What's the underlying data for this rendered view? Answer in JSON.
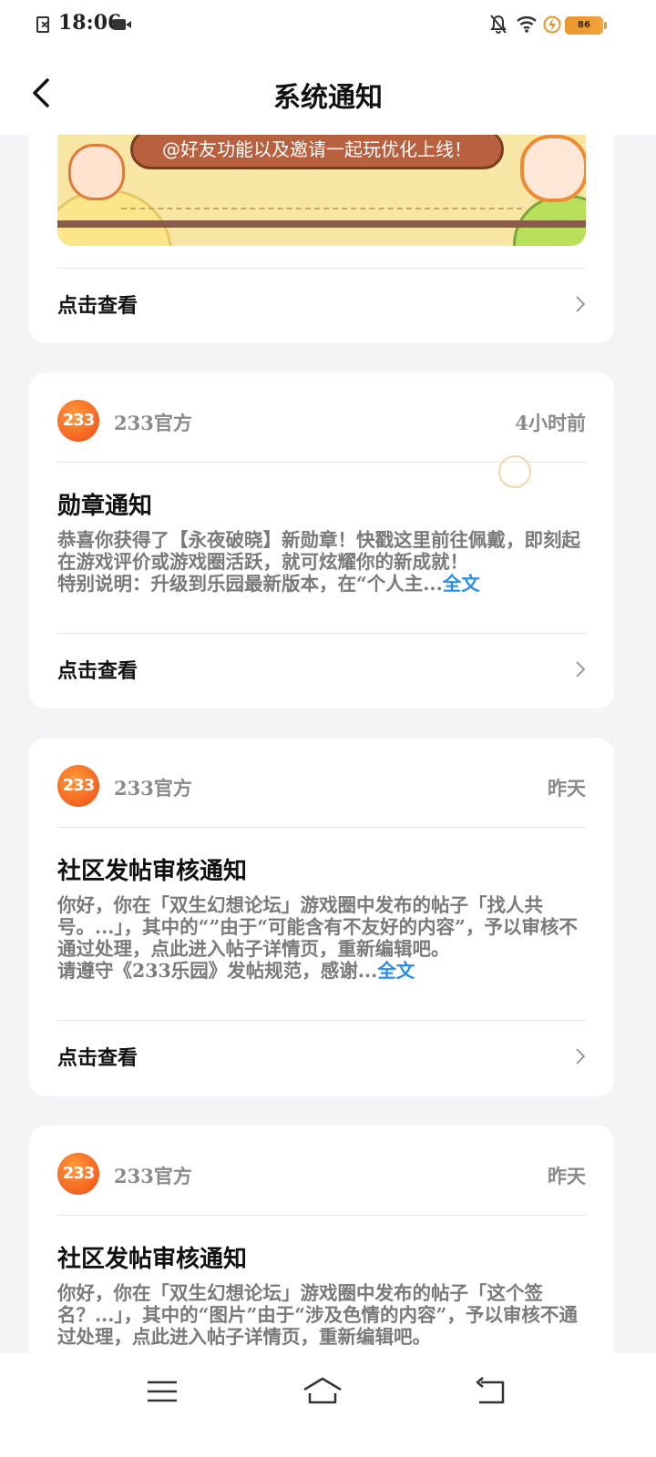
{
  "status_bar": {
    "time": "18:06",
    "battery": "86"
  },
  "nav": {
    "title": "系统通知"
  },
  "banner": {
    "text": "@好友功能以及邀请一起玩优化上线！"
  },
  "view_label": "点击查看",
  "cards": [
    {
      "sender": "233官方",
      "avatar_text": "233",
      "time": "4小时前",
      "title": "勋章通知",
      "body": "恭喜你获得了【永夜破晓】新勋章！快戳这里前往佩戴，即刻起在游戏评价或游戏圈活跃，就可炫耀你的新成就！",
      "body2": "特别说明：升级到乐园最新版本，在“个人主...",
      "more": "全文"
    },
    {
      "sender": "233官方",
      "avatar_text": "233",
      "time": "昨天",
      "title": "社区发帖审核通知",
      "body": "你好，你在「双生幻想论坛」游戏圈中发布的帖子「找人共号。...」，其中的“”由于“可能含有不友好的内容”，予以审核不通过处理，点此进入帖子详情页，重新编辑吧。",
      "body2": "请遵守《233乐园》发帖规范，感谢...",
      "more": "全文"
    },
    {
      "sender": "233官方",
      "avatar_text": "233",
      "time": "昨天",
      "title": "社区发帖审核通知",
      "body": "你好，你在「双生幻想论坛」游戏圈中发布的帖子「这个签名？...」，其中的“图片”由于“涉及色情的内容”，予以审核不通过处理，点此进入帖子详情页，重新编辑吧。"
    }
  ],
  "colors": {
    "accent_link": "#2a8ee8",
    "avatar": "#f05a1a",
    "battery": "#e8962e"
  },
  "icons": [
    "sim-off-icon",
    "video-icon",
    "bell-off-icon",
    "wifi-icon",
    "charging-icon",
    "battery-icon",
    "back-arrow-icon",
    "chevron-right-icon",
    "menu-icon",
    "home-icon",
    "back-icon"
  ]
}
